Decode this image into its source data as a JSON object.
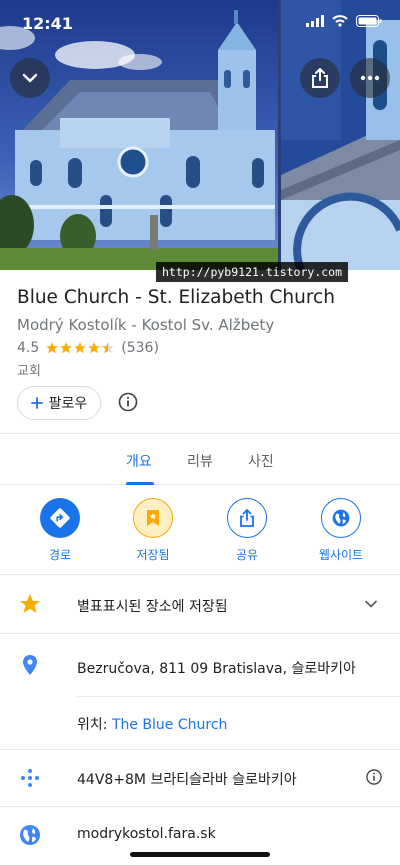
{
  "status_bar": {
    "time": "12:41"
  },
  "hero": {
    "back_icon": "chevron-down-icon",
    "share_icon": "share-icon",
    "more_icon": "more-horizontal-icon"
  },
  "watermark": "http://pyb9121.tistory.com",
  "place": {
    "title": "Blue Church - St. Elizabeth Church",
    "subtitle": "Modrý Kostolík - Kostol Sv. Alžbety",
    "rating": "4.5",
    "review_count": "(536)",
    "category": "교회",
    "follow_label": "팔로우"
  },
  "tabs": [
    {
      "label": "개요",
      "active": true
    },
    {
      "label": "리뷰",
      "active": false
    },
    {
      "label": "사진",
      "active": false
    }
  ],
  "actions": [
    {
      "label": "경로",
      "icon": "directions-icon"
    },
    {
      "label": "저장됨",
      "icon": "bookmark-icon"
    },
    {
      "label": "공유",
      "icon": "share-icon"
    },
    {
      "label": "웹사이트",
      "icon": "globe-icon"
    }
  ],
  "details": {
    "saved_text": "별표표시된 장소에 저장됨",
    "address": "Bezručova, 811 09 Bratislava, 슬로바키아",
    "located_in_label": "위치:",
    "located_in_value": "The Blue Church",
    "plus_code": "44V8+8M 브라티슬라바 슬로바키아",
    "website": "modrykostol.fara.sk"
  },
  "colors": {
    "accent": "#1a73e8",
    "star": "#f9ab00",
    "pin": "#4285f4",
    "saved_bg": "#feefc3"
  }
}
